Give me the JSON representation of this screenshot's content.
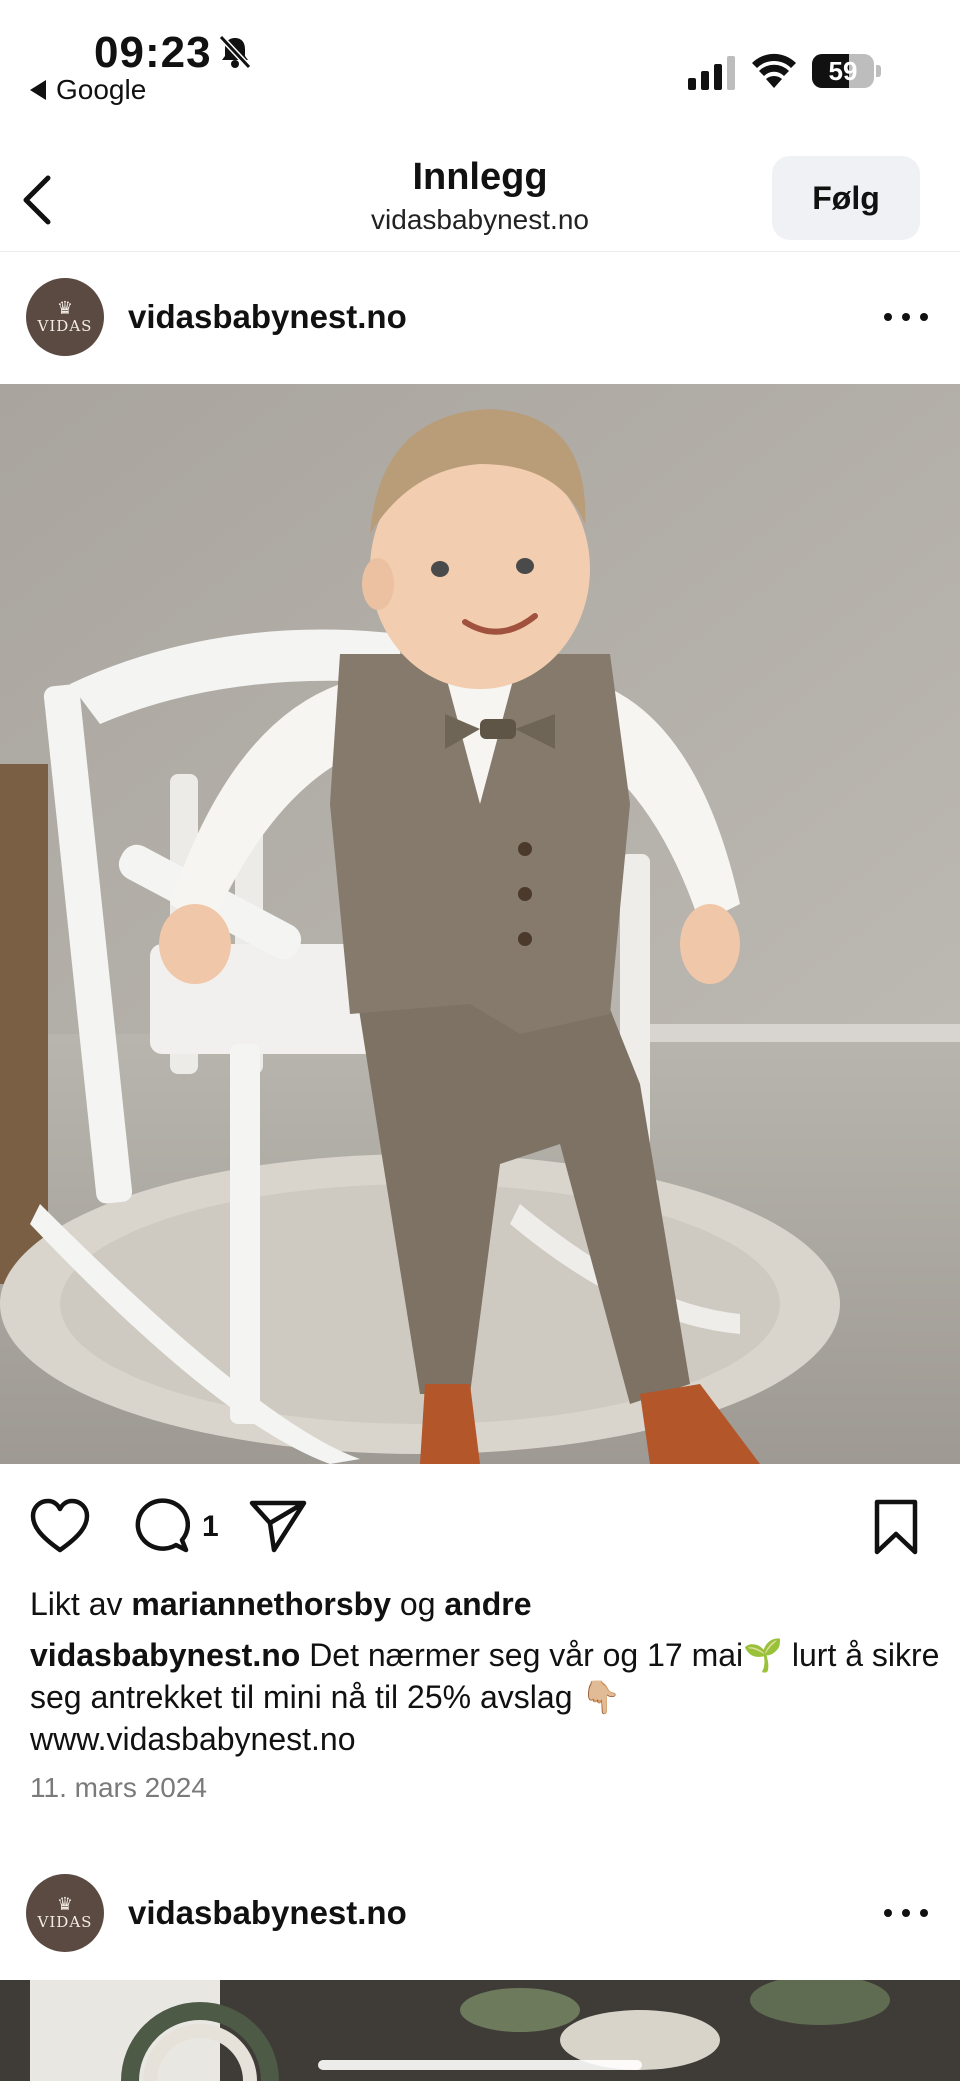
{
  "status_bar": {
    "time": "09:23",
    "back_app": "Google",
    "battery": "59",
    "battery_level": 0.59,
    "icons": [
      "bell-muted-icon",
      "cellular-signal-icon",
      "wifi-icon",
      "battery-icon"
    ]
  },
  "nav": {
    "title": "Innlegg",
    "subtitle": "vidasbabynest.no",
    "follow_label": "Følg",
    "back_icon": "chevron-left-icon"
  },
  "posts": [
    {
      "avatar_text": "VIDAS",
      "username": "vidasbabynest.no",
      "comment_count": "1",
      "liked_by_prefix": "Likt av",
      "liked_by_user": "mariannethorsby",
      "liked_by_joiner": "og",
      "liked_by_rest": "andre",
      "caption_user": "vidasbabynest.no",
      "caption_text": "Det nærmer seg vår og 17 mai🌱 lurt å sikre seg antrekket til mini nå til 25% avslag 👇🏼 www.vidasbabynest.no",
      "date": "11. mars 2024"
    },
    {
      "avatar_text": "VIDAS",
      "username": "vidasbabynest.no"
    }
  ],
  "colors": {
    "follow_bg": "#eff1f4",
    "avatar_bg": "#5b4a42",
    "date_text": "#7a7a7a"
  }
}
